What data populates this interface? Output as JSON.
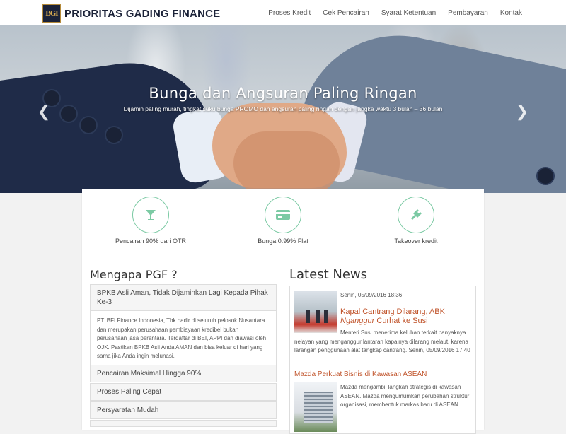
{
  "brand": {
    "logo_text": "BGI",
    "name": "PRIORITAS GADING FINANCE"
  },
  "nav": [
    "Proses Kredit",
    "Cek Pencairan",
    "Syarat Ketentuan",
    "Pembayaran",
    "Kontak"
  ],
  "hero": {
    "title": "Bunga dan Angsuran Paling Ringan",
    "subtitle": "Dijamin paling murah, tingkat suku bunga PROMO dan angsuran paling ringan dengan jangka waktu 3 bulan – 36 bulan",
    "prev_icon": "chevron-left-icon",
    "next_icon": "chevron-right-icon"
  },
  "features": [
    {
      "icon": "glass-icon",
      "label": "Pencairan 90% dari OTR"
    },
    {
      "icon": "credit-card-icon",
      "label": "Bunga 0.99% Flat"
    },
    {
      "icon": "plug-icon",
      "label": "Takeover kredit"
    }
  ],
  "colors": {
    "accent": "#7ccaa4",
    "link": "#c0532a",
    "brand_dark": "#1b2238",
    "brand_gold": "#d3a850"
  },
  "mengapa": {
    "title": "Mengapa PGF ?",
    "items": [
      {
        "title": "BPKB Asli Aman, Tidak Dijaminkan Lagi Kepada Pihak Ke-3",
        "body": "PT. BFI Finance Indonesia, Tbk hadir di seluruh pelosok Nusantara dan merupakan perusahaan pembiayaan kredibel bukan perusahaan jasa perantara. Terdaftar di BEI, APPI dan diawasi oleh OJK. Pastikan BPKB Asli Anda AMAN dan bisa keluar di hari yang sama jika Anda ingin melunasi."
      },
      {
        "title": "Pencairan Maksimal Hingga 90%"
      },
      {
        "title": "Proses Paling Cepat"
      },
      {
        "title": "Persyaratan Mudah"
      }
    ]
  },
  "news": {
    "title": "Latest News",
    "items": [
      {
        "date": "Senin, 05/09/2016 18:36",
        "headline_1": "Kapal Cantrang Dilarang, ABK ",
        "headline_italic": "Nganggur",
        "headline_2": " Curhat ke Susi",
        "summary": "Menteri Susi menerima keluhan terkait banyaknya nelayan yang menganggur lantaran kapalnya dilarang melaut, karena larangan penggunaan alat tangkap cantrang. Senin, 05/09/2016 17:40"
      },
      {
        "headline": "Mazda Perkuat Bisnis di Kawasan ASEAN",
        "summary": "Mazda mengambil langkah strategis di kawasan ASEAN. Mazda mengumumkan perubahan struktur organisasi, membentuk markas baru di ASEAN."
      }
    ]
  }
}
